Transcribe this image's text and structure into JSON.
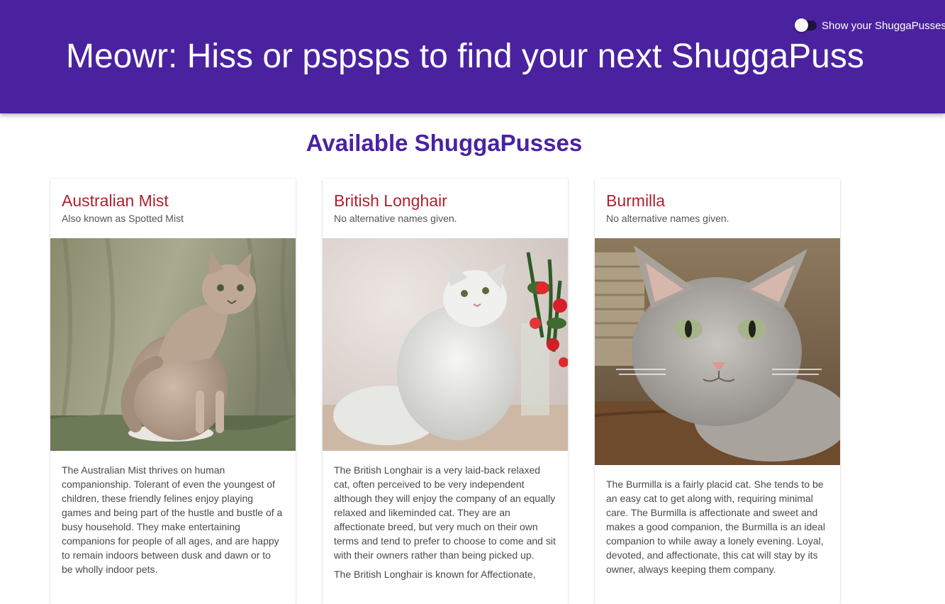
{
  "header": {
    "title": "Meowr: Hiss or pspsps to find your next ShuggaPuss",
    "toggle_label": "Show your ShuggaPusses"
  },
  "main": {
    "section_title": "Available ShuggaPusses"
  },
  "cards": [
    {
      "name": "Australian Mist",
      "subtitle": "Also known as Spotted Mist",
      "paragraphs": [
        "The Australian Mist thrives on human companionship. Tolerant of even the youngest of children, these friendly felines enjoy playing games and being part of the hustle and bustle of a busy household. They make entertaining companions for people of all ages, and are happy to remain indoors between dusk and dawn or to be wholly indoor pets."
      ]
    },
    {
      "name": "British Longhair",
      "subtitle": "No alternative names given.",
      "paragraphs": [
        "The British Longhair is a very laid-back relaxed cat, often perceived to be very independent although they will enjoy the company of an equally relaxed and likeminded cat. They are an affectionate breed, but very much on their own terms and tend to prefer to choose to come and sit with their owners rather than being picked up.",
        "The British Longhair is known for Affectionate,"
      ]
    },
    {
      "name": "Burmilla",
      "subtitle": "No alternative names given.",
      "paragraphs": [
        "The Burmilla is a fairly placid cat. She tends to be an easy cat to get along with, requiring minimal care. The Burmilla is affectionate and sweet and makes a good companion, the Burmilla is an ideal companion to while away a lonely evening. Loyal, devoted, and affectionate, this cat will stay by its owner, always keeping them company."
      ]
    }
  ],
  "colors": {
    "appbar": "#4a22a0",
    "section_title": "#4a22a0",
    "card_title": "#b0212f"
  }
}
